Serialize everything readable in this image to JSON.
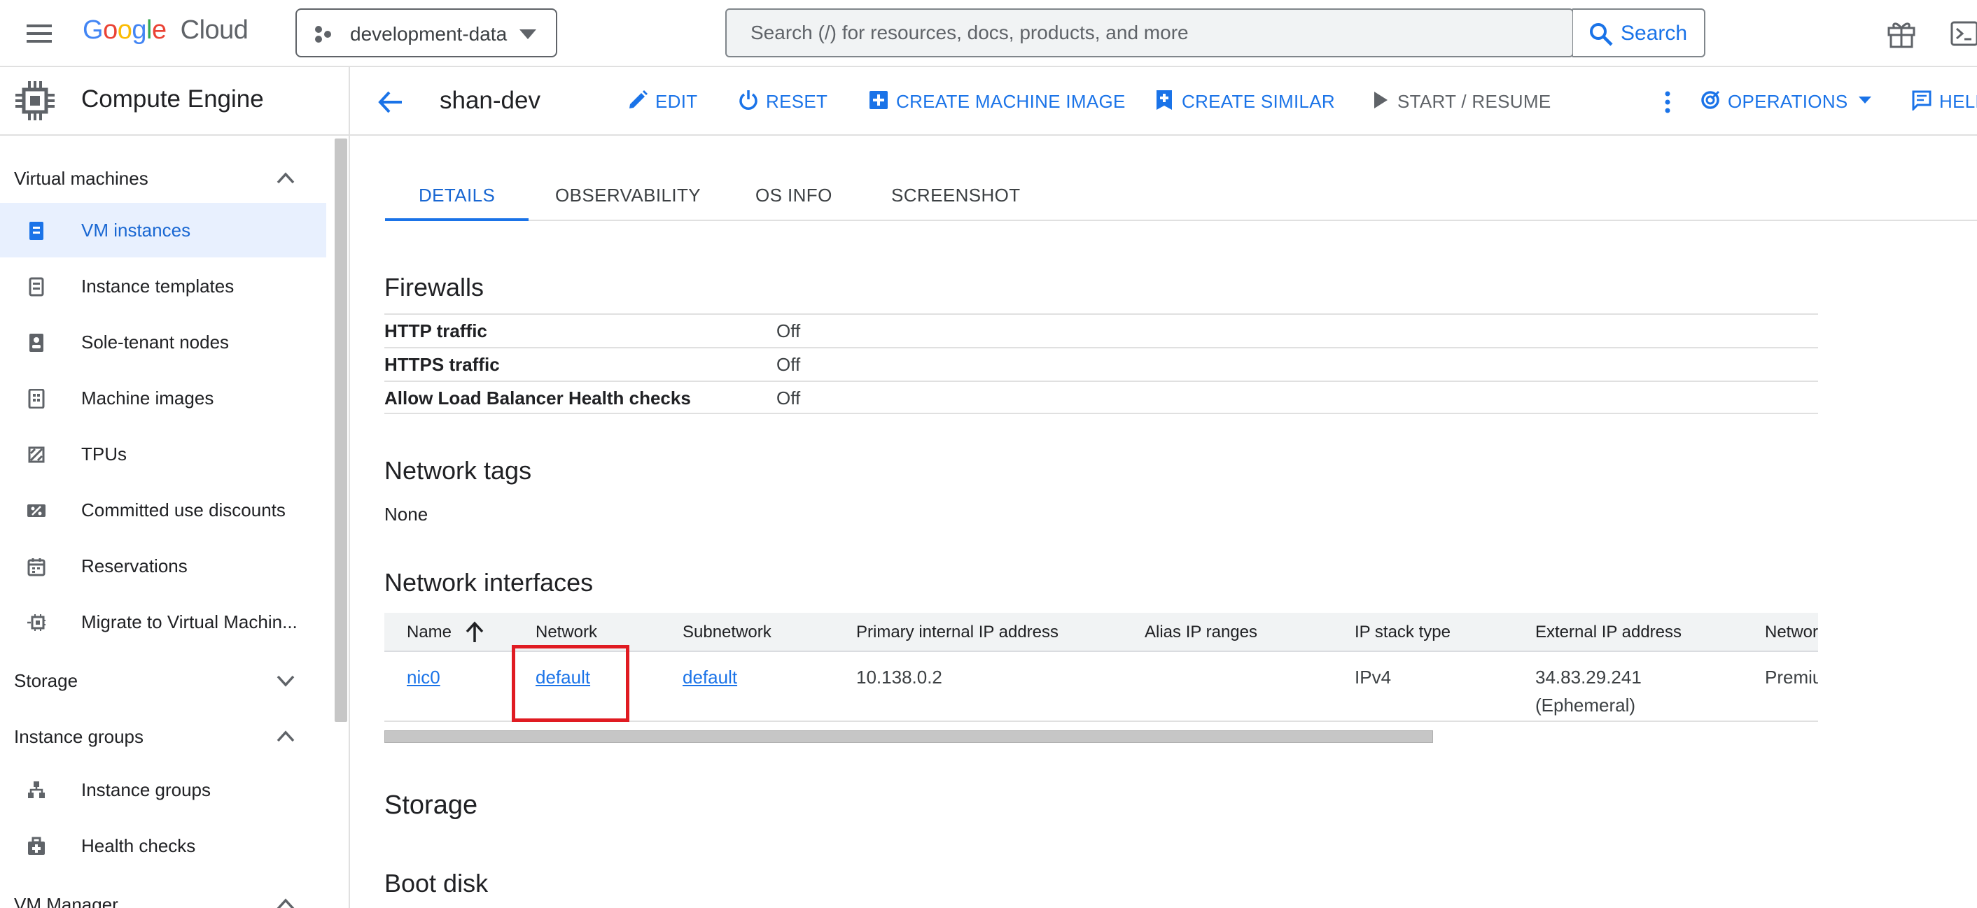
{
  "header": {
    "logo_google": "Google",
    "logo_cloud": "Cloud",
    "project_name": "development-data",
    "search_placeholder": "Search (/) for resources, docs, products, and more",
    "search_button": "Search"
  },
  "sidebar": {
    "product": "Compute Engine",
    "sections": [
      {
        "label": "Virtual machines",
        "expanded": true
      },
      {
        "label": "Storage",
        "expanded": false
      },
      {
        "label": "Instance groups",
        "expanded": true
      },
      {
        "label": "VM Manager",
        "expanded": true
      }
    ],
    "items": [
      {
        "label": "VM instances",
        "icon": "vm-instances-icon",
        "active": true
      },
      {
        "label": "Instance templates",
        "icon": "instance-templates-icon"
      },
      {
        "label": "Sole-tenant nodes",
        "icon": "sole-tenant-icon"
      },
      {
        "label": "Machine images",
        "icon": "machine-images-icon"
      },
      {
        "label": "TPUs",
        "icon": "tpu-icon"
      },
      {
        "label": "Committed use discounts",
        "icon": "discount-icon"
      },
      {
        "label": "Reservations",
        "icon": "calendar-icon"
      },
      {
        "label": "Migrate to Virtual Machin...",
        "icon": "migrate-icon"
      },
      {
        "label": "Instance groups",
        "icon": "instance-groups-icon"
      },
      {
        "label": "Health checks",
        "icon": "health-checks-icon"
      }
    ]
  },
  "actionbar": {
    "title": "shan-dev",
    "actions": [
      {
        "label": "EDIT",
        "icon": "pencil-icon"
      },
      {
        "label": "RESET",
        "icon": "power-icon"
      },
      {
        "label": "CREATE MACHINE IMAGE",
        "icon": "add-box-icon"
      },
      {
        "label": "CREATE SIMILAR",
        "icon": "add-bookmark-icon"
      },
      {
        "label": "START / RESUME",
        "icon": "play-icon",
        "disabled": true
      },
      {
        "label": "OPERATIONS",
        "icon": "operations-icon"
      },
      {
        "label": "HELP",
        "icon": "feedback-icon"
      }
    ]
  },
  "tabs": [
    {
      "label": "DETAILS",
      "active": true
    },
    {
      "label": "OBSERVABILITY"
    },
    {
      "label": "OS INFO"
    },
    {
      "label": "SCREENSHOT"
    }
  ],
  "firewalls": {
    "heading": "Firewalls",
    "rows": [
      {
        "key": "HTTP traffic",
        "value": "Off"
      },
      {
        "key": "HTTPS traffic",
        "value": "Off"
      },
      {
        "key": "Allow Load Balancer Health checks",
        "value": "Off"
      }
    ]
  },
  "network_tags": {
    "heading": "Network tags",
    "value": "None"
  },
  "network_interfaces": {
    "heading": "Network interfaces",
    "columns": [
      "Name",
      "Network",
      "Subnetwork",
      "Primary internal IP address",
      "Alias IP ranges",
      "IP stack type",
      "External IP address",
      "Network Tier"
    ],
    "rows": [
      {
        "name": "nic0",
        "network": "default",
        "subnetwork": "default",
        "primary_ip": "10.138.0.2",
        "alias_ip": "",
        "ip_stack": "IPv4",
        "external_ip": "34.83.29.241",
        "external_ip_note": "(Ephemeral)",
        "tier": "Premium"
      }
    ]
  },
  "storage": {
    "heading": "Storage"
  },
  "boot_disk": {
    "heading": "Boot disk"
  },
  "colors": {
    "accent": "#1a73e8",
    "active_nav_bg": "#e8f0fe",
    "highlight": "#e01b22"
  }
}
